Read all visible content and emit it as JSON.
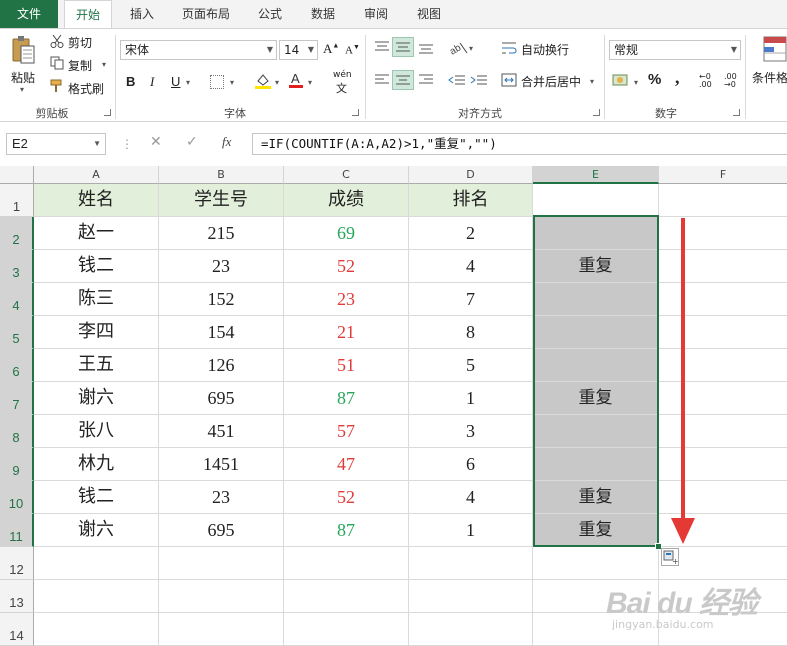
{
  "tabs": [
    "文件",
    "开始",
    "插入",
    "页面布局",
    "公式",
    "数据",
    "审阅",
    "视图"
  ],
  "active_tab": "开始",
  "ribbon": {
    "clipboard": {
      "paste": "粘贴",
      "cut": "剪切",
      "copy": "复制",
      "format_painter": "格式刷",
      "group_label": "剪贴板"
    },
    "font": {
      "font_name": "宋体",
      "font_size": "14",
      "bold": "B",
      "italic": "I",
      "underline": "U",
      "phonetic": "wén",
      "group_label": "字体"
    },
    "alignment": {
      "wrap_text": "自动换行",
      "merge_center": "合并后居中",
      "group_label": "对齐方式"
    },
    "number": {
      "format": "常规",
      "percent": "%",
      "comma": ",",
      "group_label": "数字"
    },
    "styles": {
      "conditional_format": "条件格"
    }
  },
  "formula_bar": {
    "name_box": "E2",
    "cancel": "✕",
    "confirm": "✓",
    "fx": "fx",
    "formula": "=IF(COUNTIF(A:A,A2)>1,\"重复\",\"\")"
  },
  "sheet": {
    "columns": [
      "A",
      "B",
      "C",
      "D",
      "E",
      "F"
    ],
    "rows": [
      "1",
      "2",
      "3",
      "4",
      "5",
      "6",
      "7",
      "8",
      "9",
      "10",
      "11",
      "12",
      "13",
      "14"
    ],
    "header": [
      "姓名",
      "学生号",
      "成绩",
      "排名",
      ""
    ],
    "data": [
      [
        "赵一",
        "215",
        "69",
        "2",
        ""
      ],
      [
        "钱二",
        "23",
        "52",
        "4",
        "重复"
      ],
      [
        "陈三",
        "152",
        "23",
        "7",
        ""
      ],
      [
        "李四",
        "154",
        "21",
        "8",
        ""
      ],
      [
        "王五",
        "126",
        "51",
        "5",
        ""
      ],
      [
        "谢六",
        "695",
        "87",
        "1",
        "重复"
      ],
      [
        "张八",
        "451",
        "57",
        "3",
        ""
      ],
      [
        "林九",
        "1451",
        "47",
        "6",
        ""
      ],
      [
        "钱二",
        "23",
        "52",
        "4",
        "重复"
      ],
      [
        "谢六",
        "695",
        "87",
        "1",
        "重复"
      ]
    ],
    "score_colors": [
      "green",
      "red",
      "red",
      "red",
      "red",
      "green",
      "red",
      "red",
      "red",
      "green"
    ]
  },
  "colors": {
    "excel_green": "#217346",
    "header_fill": "#e2efda",
    "selection_fill": "#c8c8c8",
    "pass_green": "#26a65b",
    "fail_red": "#e03a3a",
    "arrow_red": "#e53935"
  },
  "watermark": {
    "main": "Bai du 经验",
    "sub": "jingyan.baidu.com"
  }
}
